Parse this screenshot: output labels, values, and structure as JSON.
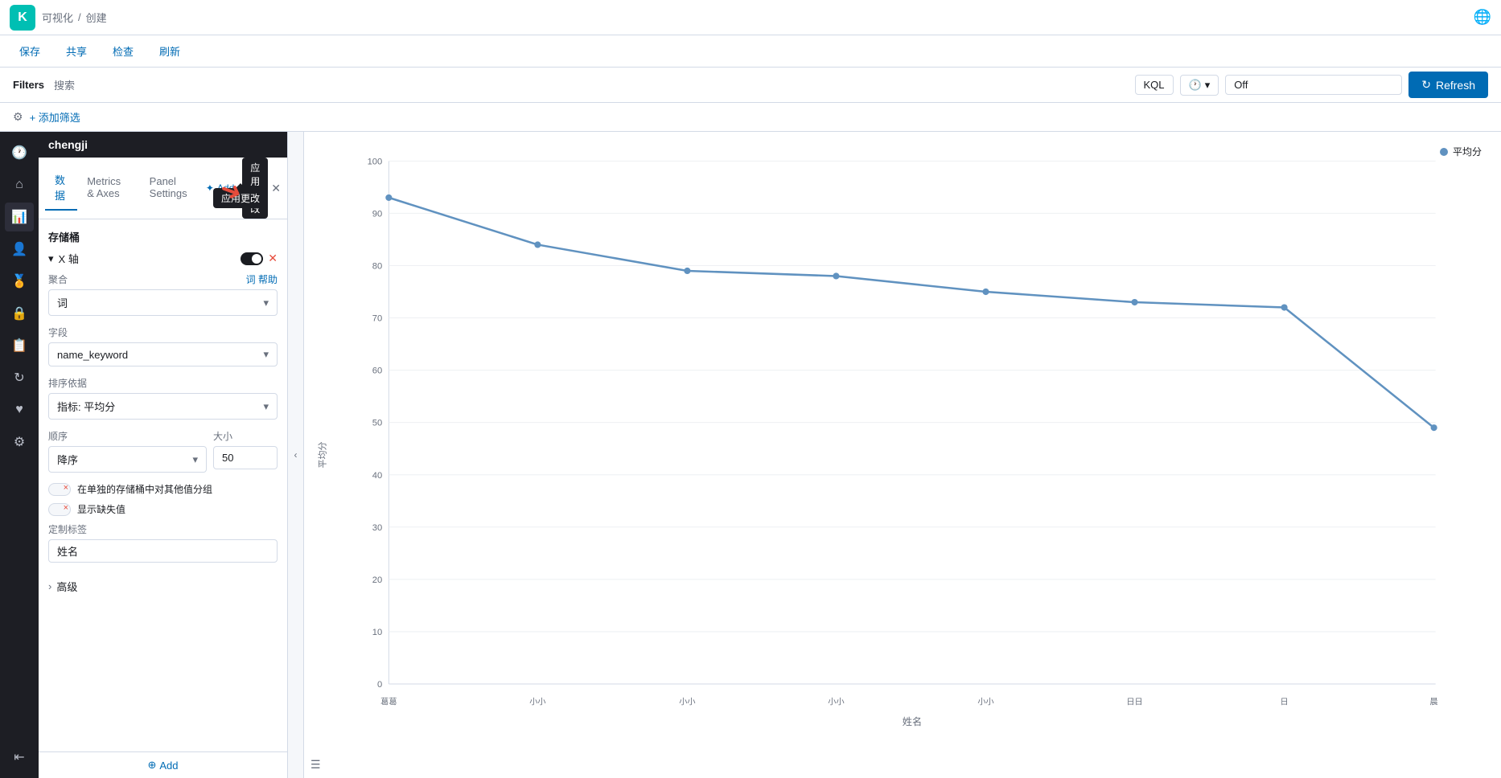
{
  "app": {
    "logo_letter": "K",
    "breadcrumb_parent": "可视化",
    "breadcrumb_separator": "/",
    "breadcrumb_current": "创建"
  },
  "actionbar": {
    "save_label": "保存",
    "share_label": "共享",
    "inspect_label": "检查",
    "refresh_label": "刷新"
  },
  "filterbar": {
    "filters_label": "Filters",
    "search_label": "搜索",
    "kql_label": "KQL",
    "off_value": "Off",
    "refresh_label": "Refresh"
  },
  "settings_row": {
    "add_filter_label": "+ 添加筛选"
  },
  "panel": {
    "title": "chengji",
    "tab_data": "数据",
    "tab_metrics": "Metrics & Axes",
    "tab_panel_settings": "Panel Settings",
    "add_label": "Add",
    "apply_label": "应用更改",
    "section_bucket": "存储桶",
    "x_axis_label": "X 轴",
    "aggregation_label": "聚合",
    "aggregation_help": "词 帮助",
    "aggregation_value": "词",
    "field_label": "字段",
    "field_value": "name_keyword",
    "sort_label": "排序依据",
    "sort_value": "指标: 平均分",
    "order_label": "顺序",
    "order_value": "降序",
    "size_label": "大小",
    "size_value": "50",
    "other_bucket_label": "在单独的存储桶中对其他值分组",
    "missing_values_label": "显示缺失值",
    "custom_label_section": "定制标签",
    "custom_label_value": "姓名",
    "advanced_label": "高级",
    "add_bottom_label": "Add"
  },
  "chart": {
    "legend_label": "平均分",
    "y_axis_label": "平均分",
    "x_axis_label": "姓名",
    "data_points": [
      {
        "x": 0,
        "y": 93
      },
      {
        "x": 1,
        "y": 84
      },
      {
        "x": 2,
        "y": 79
      },
      {
        "x": 3,
        "y": 78
      },
      {
        "x": 4,
        "y": 75
      },
      {
        "x": 5,
        "y": 73
      },
      {
        "x": 6,
        "y": 72
      },
      {
        "x": 7,
        "y": 49
      }
    ],
    "x_labels": [
      "葛葛",
      "小小",
      "小小",
      "小小",
      "小小",
      "日日",
      "日",
      "晨"
    ],
    "y_ticks": [
      0,
      10,
      20,
      30,
      40,
      50,
      60,
      70,
      80,
      90,
      100
    ],
    "accent_color": "#6092c0"
  },
  "sidebar": {
    "icons": [
      "🕐",
      "🏠",
      "📊",
      "👤",
      "⚙️",
      "🔒",
      "📋",
      "🔄",
      "♥",
      "⚙"
    ]
  }
}
